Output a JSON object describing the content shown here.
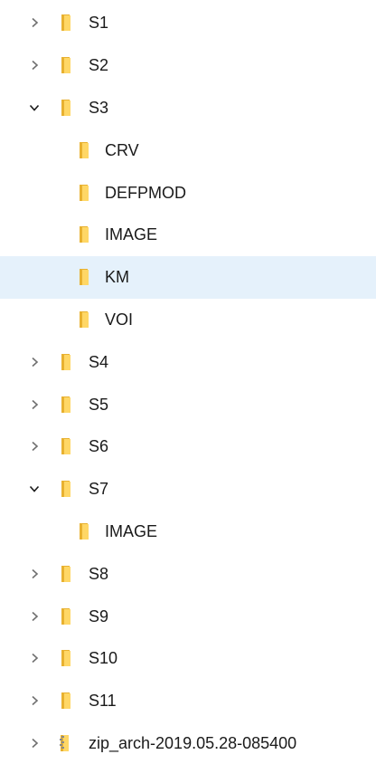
{
  "tree": {
    "items": [
      {
        "label": "S1",
        "level": 0,
        "expandable": true,
        "expanded": false,
        "icon": "folder-icon",
        "selected": false
      },
      {
        "label": "S2",
        "level": 0,
        "expandable": true,
        "expanded": false,
        "icon": "folder-icon",
        "selected": false
      },
      {
        "label": "S3",
        "level": 0,
        "expandable": true,
        "expanded": true,
        "icon": "folder-icon",
        "selected": false
      },
      {
        "label": "CRV",
        "level": 1,
        "expandable": false,
        "expanded": false,
        "icon": "folder-icon",
        "selected": false
      },
      {
        "label": "DEFPMOD",
        "level": 1,
        "expandable": false,
        "expanded": false,
        "icon": "folder-icon",
        "selected": false
      },
      {
        "label": "IMAGE",
        "level": 1,
        "expandable": false,
        "expanded": false,
        "icon": "folder-icon",
        "selected": false
      },
      {
        "label": "KM",
        "level": 1,
        "expandable": false,
        "expanded": false,
        "icon": "folder-icon",
        "selected": true
      },
      {
        "label": "VOI",
        "level": 1,
        "expandable": false,
        "expanded": false,
        "icon": "folder-icon",
        "selected": false
      },
      {
        "label": "S4",
        "level": 0,
        "expandable": true,
        "expanded": false,
        "icon": "folder-icon",
        "selected": false
      },
      {
        "label": "S5",
        "level": 0,
        "expandable": true,
        "expanded": false,
        "icon": "folder-icon",
        "selected": false
      },
      {
        "label": "S6",
        "level": 0,
        "expandable": true,
        "expanded": false,
        "icon": "folder-icon",
        "selected": false
      },
      {
        "label": "S7",
        "level": 0,
        "expandable": true,
        "expanded": true,
        "icon": "folder-icon",
        "selected": false
      },
      {
        "label": "IMAGE",
        "level": 1,
        "expandable": false,
        "expanded": false,
        "icon": "folder-icon",
        "selected": false
      },
      {
        "label": "S8",
        "level": 0,
        "expandable": true,
        "expanded": false,
        "icon": "folder-icon",
        "selected": false
      },
      {
        "label": "S9",
        "level": 0,
        "expandable": true,
        "expanded": false,
        "icon": "folder-icon",
        "selected": false
      },
      {
        "label": "S10",
        "level": 0,
        "expandable": true,
        "expanded": false,
        "icon": "folder-icon",
        "selected": false
      },
      {
        "label": "S11",
        "level": 0,
        "expandable": true,
        "expanded": false,
        "icon": "folder-icon",
        "selected": false
      },
      {
        "label": "zip_arch-2019.05.28-085400",
        "level": 0,
        "expandable": true,
        "expanded": false,
        "icon": "zip-folder-icon",
        "selected": false
      }
    ]
  },
  "colors": {
    "selected_background": "#e5f1fb",
    "folder_front": "#ffd766",
    "folder_back": "#e8b130",
    "chevron": "#707070",
    "text": "#1a1a1a"
  }
}
